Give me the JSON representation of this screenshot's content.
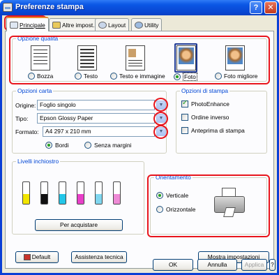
{
  "window": {
    "title": "Preferenze stampa",
    "help_label": "?",
    "close_label": "✕"
  },
  "tabs": [
    {
      "label": "Principale",
      "active": true,
      "icon": "printer-icon"
    },
    {
      "label": "Altre impost.",
      "active": false,
      "icon": "settings-icon"
    },
    {
      "label": "Layout",
      "active": false,
      "icon": "layout-icon"
    },
    {
      "label": "Utility",
      "active": false,
      "icon": "utility-icon"
    }
  ],
  "quality": {
    "title": "Opzione qualità",
    "options": [
      {
        "label": "Bozza",
        "selected": false
      },
      {
        "label": "Testo",
        "selected": false
      },
      {
        "label": "Testo e immagine",
        "selected": false
      },
      {
        "label": "Foto",
        "selected": true
      },
      {
        "label": "Foto migliore",
        "selected": false
      }
    ]
  },
  "paper": {
    "title": "Opzioni carta",
    "source_label": "Origine:",
    "source_value": "Foglio singolo",
    "type_label": "Tipo:",
    "type_value": "Epson Glossy Paper",
    "size_label": "Formato:",
    "size_value": "A4 297 x 210 mm",
    "borders_label": "Bordi",
    "borderless_label": "Senza margini",
    "borders_selected": true
  },
  "print_options": {
    "title": "Opzioni di stampa",
    "items": [
      {
        "label": "PhotoEnhance",
        "checked": true
      },
      {
        "label": "Ordine inverso",
        "checked": false
      },
      {
        "label": "Anteprima di stampa",
        "checked": false
      }
    ]
  },
  "ink": {
    "title": "Livelli inchiostro",
    "buy_label": "Per acquistare",
    "cartridges": [
      {
        "color": "#f2e500",
        "level": 0.45
      },
      {
        "color": "#111111",
        "level": 0.45
      },
      {
        "color": "#23c6e8",
        "level": 0.45
      },
      {
        "color": "#e83fc8",
        "level": 0.45
      },
      {
        "color": "#7fd6ef",
        "level": 0.45
      },
      {
        "color": "#ee8ad6",
        "level": 0.45
      }
    ]
  },
  "orientation": {
    "title": "Orientamento",
    "portrait_label": "Verticale",
    "landscape_label": "Orizzontale",
    "portrait_selected": true
  },
  "bottom": {
    "default_label": "Default",
    "support_label": "Assistenza tecnica",
    "show_settings_label": "Mostra impostazioni",
    "ok_label": "OK",
    "cancel_label": "Annulla",
    "apply_label": "Applica",
    "help_label": "?"
  }
}
